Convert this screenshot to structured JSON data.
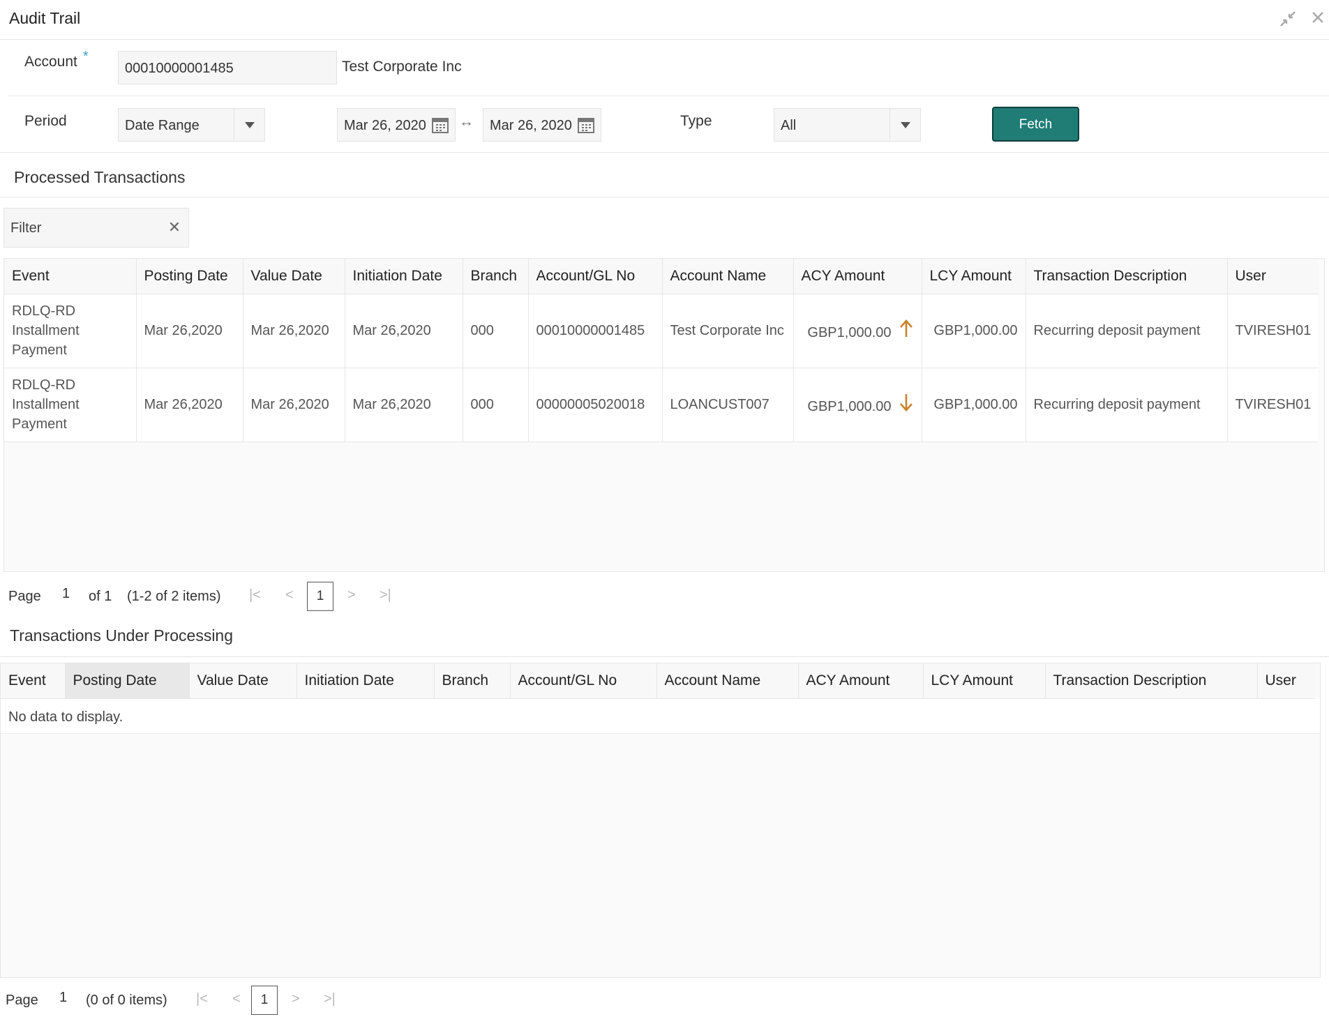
{
  "header": {
    "title": "Audit Trail",
    "icons": [
      "minimize-icon",
      "close-icon"
    ]
  },
  "account": {
    "label": "Account",
    "required_mark": "*",
    "value": "00010000001485",
    "name": "Test Corporate Inc"
  },
  "period": {
    "label": "Period",
    "mode": "Date Range",
    "from_date": "Mar 26, 2020",
    "to_date": "Mar 26, 2020",
    "range_symbol": "↔"
  },
  "type": {
    "label": "Type",
    "value": "All"
  },
  "fetch": {
    "label": "Fetch"
  },
  "processed": {
    "title": "Processed Transactions",
    "filter_placeholder": "Filter",
    "columns": [
      "Event",
      "Posting Date",
      "Value Date",
      "Initiation Date",
      "Branch",
      "Account/GL No",
      "Account Name",
      "ACY Amount",
      "LCY Amount",
      "Transaction Description",
      "User"
    ],
    "rows": [
      {
        "event": "RDLQ-RD Installment Payment",
        "posting_date": "Mar 26,2020",
        "value_date": "Mar 26,2020",
        "initiation_date": "Mar 26,2020",
        "branch": "000",
        "account_gl": "00010000001485",
        "account_name": "Test Corporate Inc",
        "acy_amount": "GBP1,000.00",
        "direction": "up",
        "lcy_amount": "GBP1,000.00",
        "description": "Recurring deposit payment",
        "user": "TVIRESH01"
      },
      {
        "event": "RDLQ-RD Installment Payment",
        "posting_date": "Mar 26,2020",
        "value_date": "Mar 26,2020",
        "initiation_date": "Mar 26,2020",
        "branch": "000",
        "account_gl": "00000005020018",
        "account_name": "LOANCUST007",
        "acy_amount": "GBP1,000.00",
        "direction": "down",
        "lcy_amount": "GBP1,000.00",
        "description": "Recurring deposit payment",
        "user": "TVIRESH01"
      }
    ],
    "pager": {
      "page_label": "Page",
      "page": "1",
      "of": "of 1",
      "items": "(1-2 of 2 items)",
      "current": "1"
    }
  },
  "under_processing": {
    "title": "Transactions Under Processing",
    "columns": [
      "Event",
      "Posting Date",
      "Value Date",
      "Initiation Date",
      "Branch",
      "Account/GL No",
      "Account Name",
      "ACY Amount",
      "LCY Amount",
      "Transaction Description",
      "User"
    ],
    "empty_text": "No data to display.",
    "pager": {
      "page_label": "Page",
      "page": "1",
      "items": "(0 of 0 items)",
      "current": "1"
    }
  },
  "colors": {
    "accent": "#1f7d76",
    "arrow": "#c8832a",
    "required": "#3aa0c8"
  }
}
